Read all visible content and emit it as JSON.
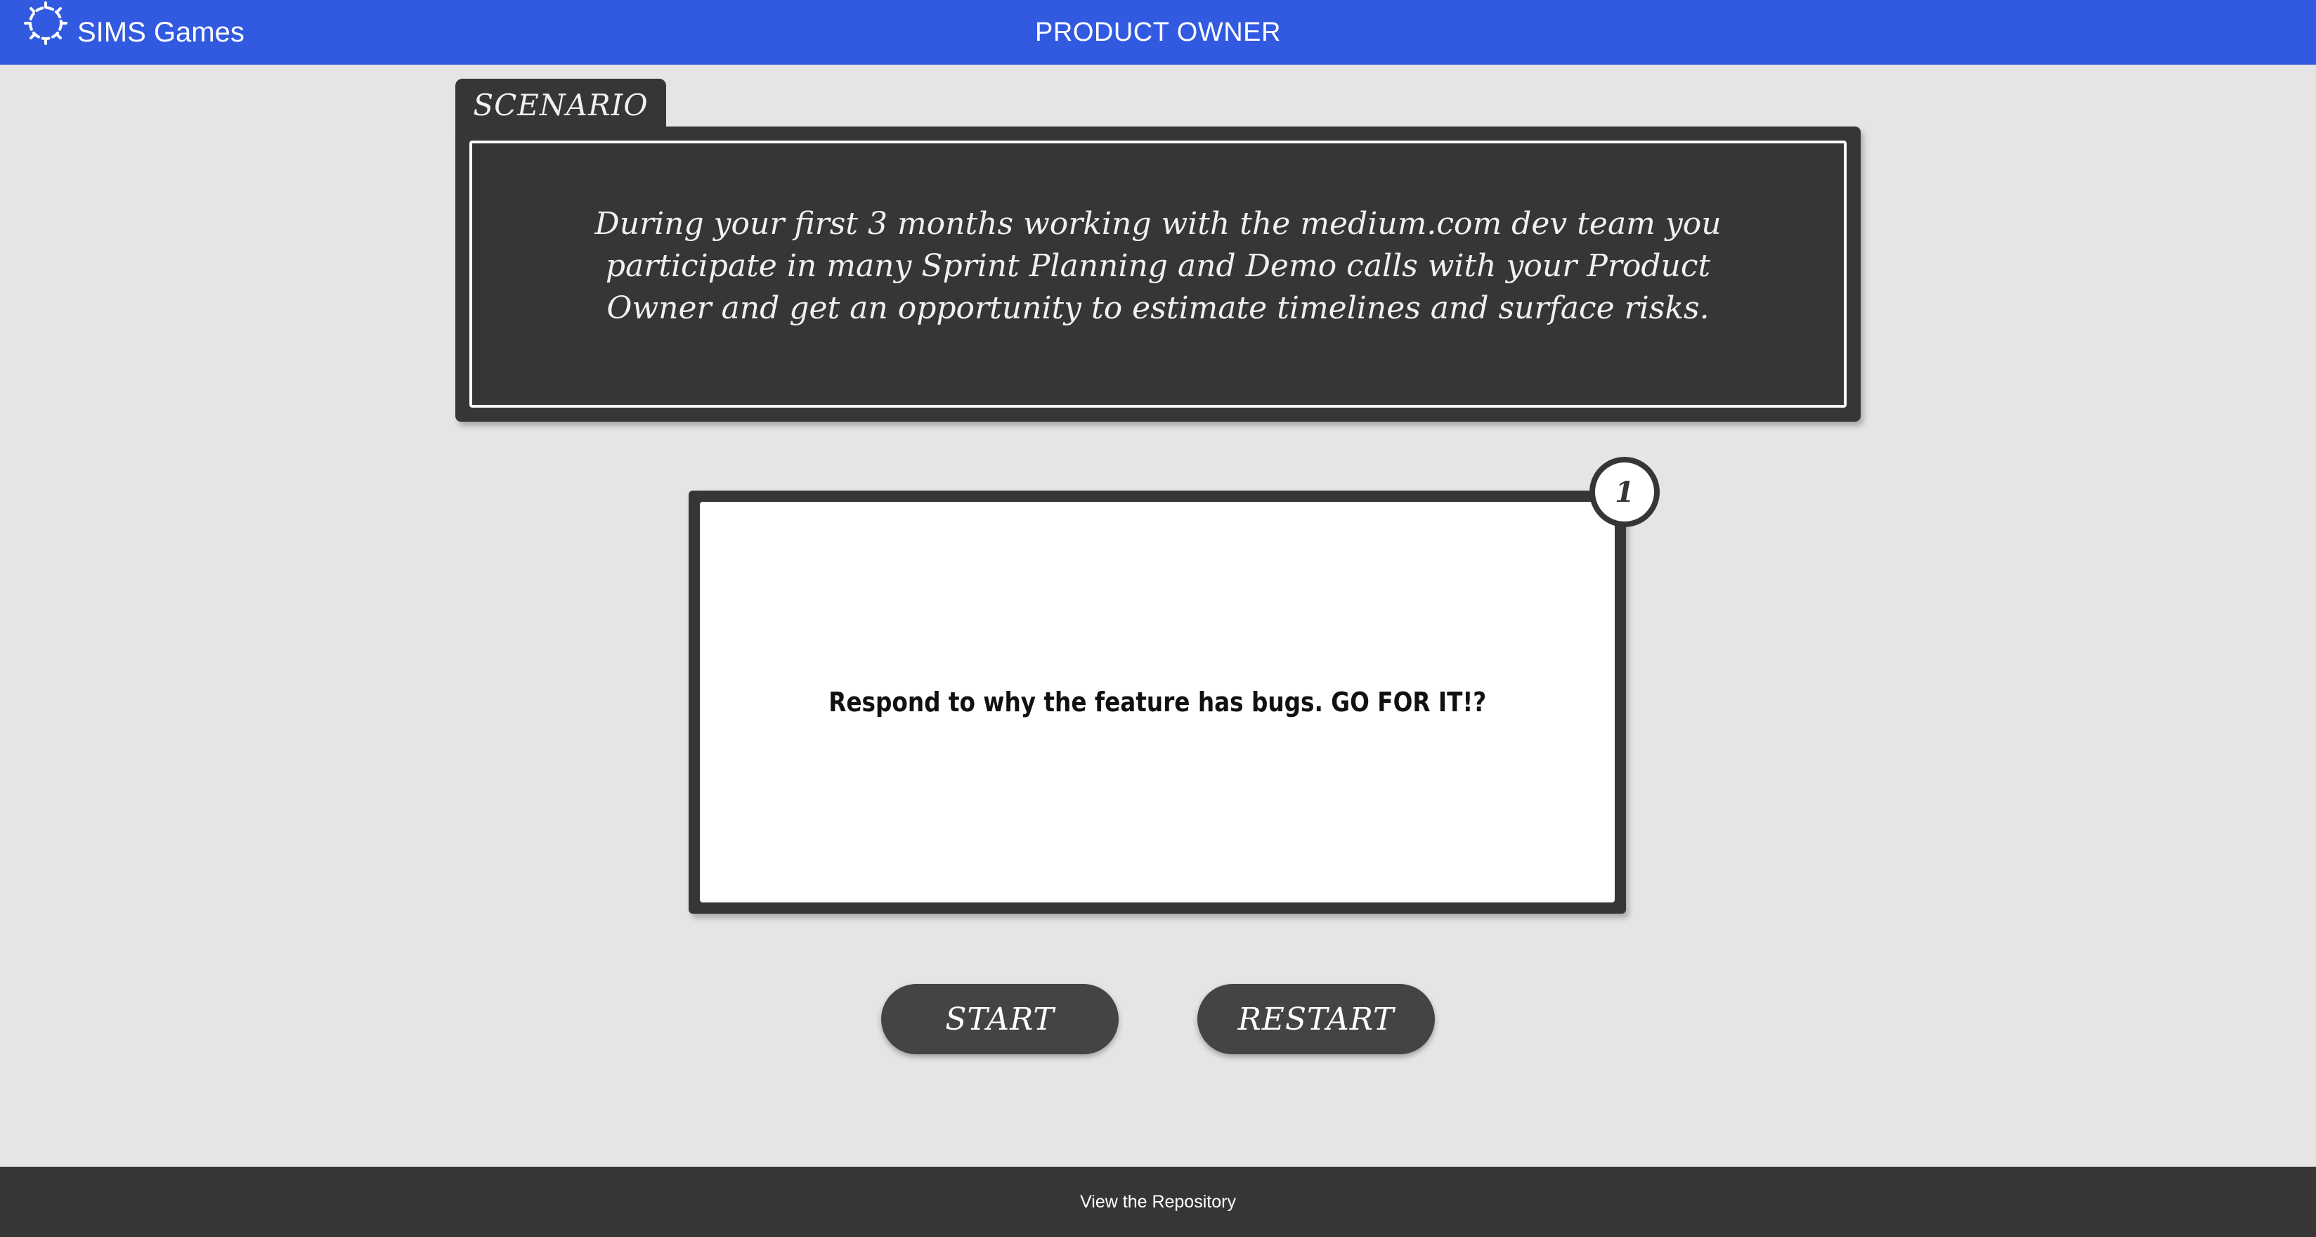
{
  "header": {
    "brand_icon": "badge-gear-icon",
    "brand_label": "SIMS Games",
    "title": "PRODUCT OWNER",
    "background_color": "#325ae0"
  },
  "scenario": {
    "tab_label": "SCENARIO",
    "text": "During your first 3 months working with the medium.com dev team you participate in many Sprint Planning and Demo calls with your Product Owner and get an opportunity to estimate timelines and surface risks."
  },
  "card": {
    "number": "1",
    "question": "Respond to why the feature has bugs. GO FOR IT!?"
  },
  "buttons": {
    "start_label": "START",
    "restart_label": "RESTART"
  },
  "footer": {
    "link_label": "View the Repository"
  }
}
